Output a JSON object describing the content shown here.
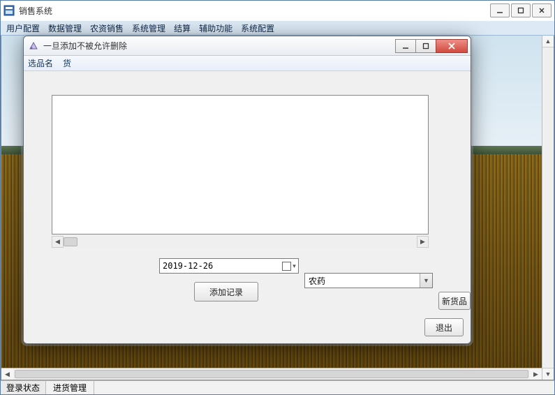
{
  "main": {
    "title": "销售系统",
    "menus": [
      "用户配置",
      "数据管理",
      "农资销售",
      "系统管理",
      "结算",
      "辅助功能",
      "系统配置"
    ]
  },
  "dialog": {
    "title": "一旦添加不被允许删除",
    "menus": [
      "选品名",
      "货"
    ],
    "date": "2019-12-26",
    "add_button": "添加记录",
    "dropdown_value": "农药",
    "new_button": "新货品",
    "exit_button": "退出"
  },
  "status": {
    "panel1": "登录状态",
    "panel2": "进货管理"
  }
}
